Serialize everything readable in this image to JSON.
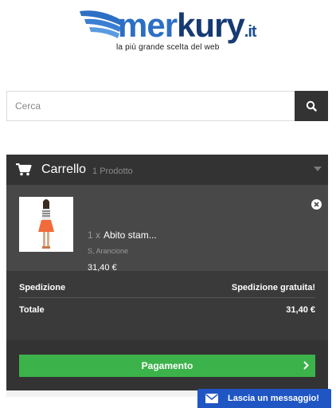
{
  "logo": {
    "brand_a": "mer",
    "brand_b": "kury",
    "tld": ".it",
    "tagline": "la più grande scelta del web"
  },
  "search": {
    "placeholder": "Cerca",
    "button_icon": "search-icon"
  },
  "cart": {
    "title": "Carrello",
    "count": "1 Prodotto",
    "icon": "cart-icon",
    "item": {
      "qty": "1 x",
      "name": "Abito stam...",
      "variant": "S, Arancione",
      "price": "31,40 €"
    },
    "shipping_label": "Spedizione",
    "shipping_value": "Spedizione gratuita!",
    "total_label": "Totale",
    "total_value": "31,40 €",
    "checkout_label": "Pagamento"
  },
  "chat": {
    "label": "Lascia un messaggio!"
  },
  "colors": {
    "brand_blue": "#2c6fc4",
    "panel_dark": "#333333",
    "checkout_green": "#3cb34a",
    "chat_blue": "#1f56c4"
  }
}
